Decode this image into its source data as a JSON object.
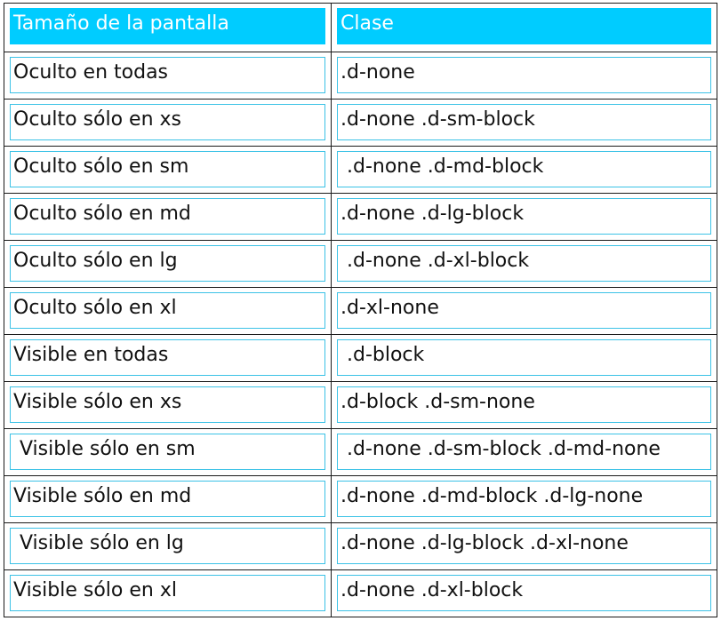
{
  "headers": {
    "col1": "Tamaño de la pantalla",
    "col2": "Clase"
  },
  "rows": [
    {
      "size": "Oculto en todas",
      "class": ".d-none"
    },
    {
      "size": "Oculto sólo en xs",
      "class": ".d-none .d-sm-block"
    },
    {
      "size": "Oculto sólo en sm",
      "class": " .d-none .d-md-block"
    },
    {
      "size": "Oculto sólo en md",
      "class": ".d-none .d-lg-block"
    },
    {
      "size": "Oculto sólo en lg",
      "class": " .d-none .d-xl-block"
    },
    {
      "size": "Oculto sólo en xl",
      "class": ".d-xl-none"
    },
    {
      "size": "Visible en todas",
      "class": " .d-block"
    },
    {
      "size": "Visible sólo en xs",
      "class": ".d-block .d-sm-none"
    },
    {
      "size": " Visible sólo en sm",
      "class": " .d-none .d-sm-block .d-md-none"
    },
    {
      "size": "Visible sólo en md",
      "class": ".d-none .d-md-block .d-lg-none"
    },
    {
      "size": " Visible sólo en lg",
      "class": ".d-none .d-lg-block .d-xl-none"
    },
    {
      "size": "Visible sólo en xl",
      "class": ".d-none .d-xl-block"
    }
  ],
  "colors": {
    "header_bg": "#00ccff",
    "cell_border": "#3cc2e6",
    "grid_border": "#1a1a1a"
  }
}
